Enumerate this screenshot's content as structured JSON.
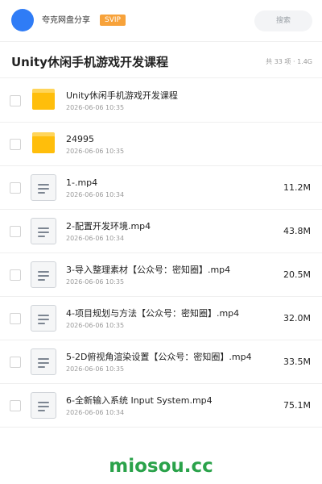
{
  "header": {
    "username": "夸克网盘分享",
    "vip_badge": "SVIP",
    "search_label": "搜索",
    "accent": "#2f7cf6"
  },
  "folder": {
    "title": "Unity休闲手机游戏开发课程",
    "summary": "共 33 项 · 1.4G"
  },
  "items": [
    {
      "type": "folder",
      "name": "Unity休闲手机游戏开发课程",
      "time": "2026-06-06 10:35",
      "size": ""
    },
    {
      "type": "folder",
      "name": "24995",
      "time": "2026-06-06 10:35",
      "size": ""
    },
    {
      "type": "file",
      "name": "1-.mp4",
      "time": "2026-06-06 10:34",
      "size": "11.2M"
    },
    {
      "type": "file",
      "name": "2-配置开发环境.mp4",
      "time": "2026-06-06 10:34",
      "size": "43.8M"
    },
    {
      "type": "file",
      "name": "3-导入整理素材【公众号：密知圈】.mp4",
      "time": "2026-06-06 10:35",
      "size": "20.5M"
    },
    {
      "type": "file",
      "name": "4-项目规划与方法【公众号：密知圈】.mp4",
      "time": "2026-06-06 10:35",
      "size": "32.0M"
    },
    {
      "type": "file",
      "name": "5-2D俯视角渲染设置【公众号：密知圈】.mp4",
      "time": "2026-06-06 10:35",
      "size": "33.5M"
    },
    {
      "type": "file",
      "name": "6-全新输入系统 Input System.mp4",
      "time": "2026-06-06 10:34",
      "size": "75.1M"
    }
  ],
  "watermark": "miosou.cc"
}
